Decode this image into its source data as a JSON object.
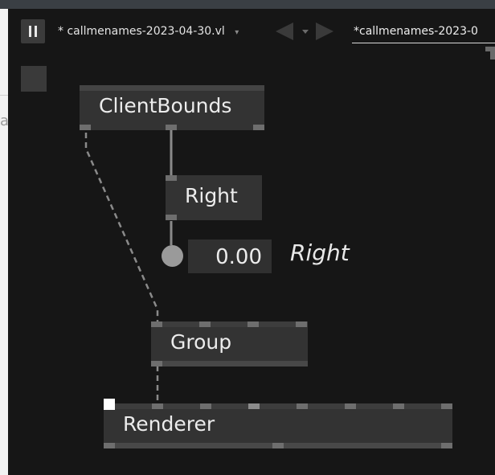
{
  "toolbar": {
    "pause_icon": "pause-icon",
    "tab1_label": "* callmenames-2023-04-30.vl",
    "tab1_chevron": "▾",
    "back_arrow": "◀",
    "nav_chevron": "▾",
    "forward_arrow": "▶",
    "tab2_label": "*callmenames-2023-0"
  },
  "left_strip_char": "a",
  "nodes": {
    "clientbounds": "ClientBounds",
    "right": "Right",
    "group": "Group",
    "renderer": "Renderer"
  },
  "iobox": {
    "value": "0.00",
    "label": "Right"
  },
  "colors": {
    "background": "#161616",
    "node": "#333333",
    "pin": "#6e6e6e",
    "link": "#8a8a8a",
    "text": "#ececec"
  }
}
